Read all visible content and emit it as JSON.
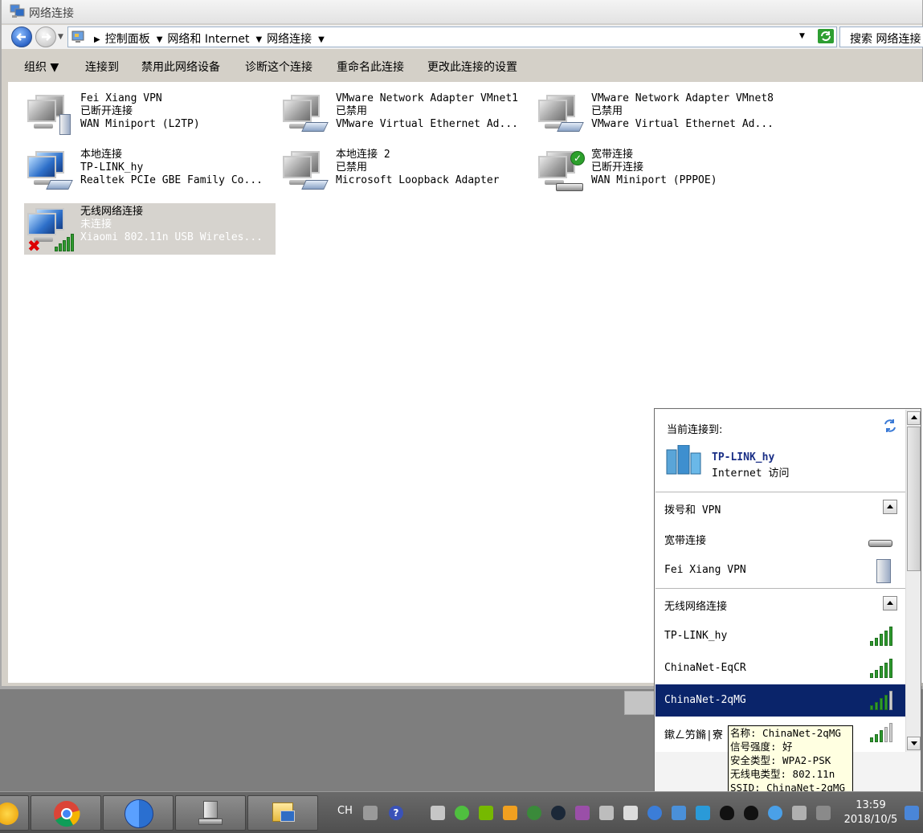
{
  "window": {
    "title": "网络连接"
  },
  "address": {
    "crumbs": [
      "控制面板",
      "网络和 Internet",
      "网络连接"
    ],
    "search_placeholder": "搜索 网络连接"
  },
  "toolbar": {
    "organize": "组织 ▼",
    "connect_to": "连接到",
    "disable": "禁用此网络设备",
    "diagnose": "诊断这个连接",
    "rename": "重命名此连接",
    "change_settings": "更改此连接的设置"
  },
  "connections": [
    {
      "name": "Fei Xiang VPN",
      "status": "已断开连接",
      "device": "WAN Miniport (L2TP)"
    },
    {
      "name": "VMware Network Adapter VMnet1",
      "status": "已禁用",
      "device": "VMware Virtual Ethernet Ad..."
    },
    {
      "name": "VMware Network Adapter VMnet8",
      "status": "已禁用",
      "device": "VMware Virtual Ethernet Ad..."
    },
    {
      "name": "本地连接",
      "status": "TP-LINK_hy",
      "device": "Realtek PCIe GBE Family Co..."
    },
    {
      "name": "本地连接 2",
      "status": "已禁用",
      "device": "Microsoft Loopback Adapter"
    },
    {
      "name": "宽带连接",
      "status": "已断开连接",
      "device": "WAN Miniport (PPPOE)"
    },
    {
      "name": "无线网络连接",
      "status": "未连接",
      "device": "Xiaomi 802.11n USB Wireles..."
    }
  ],
  "flyout": {
    "current_label": "当前连接到:",
    "current_network": "TP-LINK_hy",
    "current_access": "Internet 访问",
    "dialup_header": "拨号和 VPN",
    "dialup_items": [
      "宽带连接",
      "Fei Xiang VPN"
    ],
    "wireless_header": "无线网络连接",
    "wireless_items": [
      {
        "name": "TP-LINK_hy",
        "signal": 5
      },
      {
        "name": "ChinaNet-EqCR",
        "signal": 5
      },
      {
        "name": "ChinaNet-2qMG",
        "signal": 4
      },
      {
        "name": "鏉ㄥ竻鏅|寮",
        "signal": 3
      }
    ]
  },
  "tooltip": {
    "line1": "名称: ChinaNet-2qMG",
    "line2": "信号强度: 好",
    "line3": "安全类型: WPA2-PSK",
    "line4": "无线电类型: 802.11n",
    "line5": "SSID: ChinaNet-2qMG"
  },
  "taskbar": {
    "lang": "CH",
    "time": "13:59",
    "date": "2018/10/5"
  }
}
